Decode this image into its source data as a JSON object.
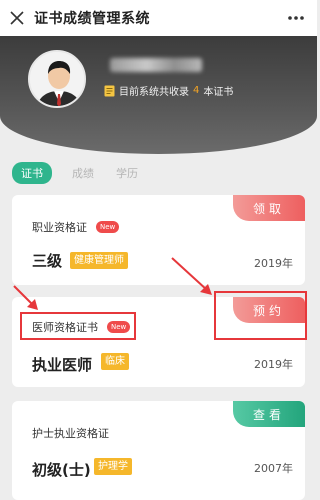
{
  "navbar": {
    "title": "证书成绩管理系统",
    "close_icon": "close-icon",
    "more_icon": "more-dots-icon"
  },
  "hero": {
    "summary_prefix": "目前系统共收录",
    "cert_count": "4",
    "summary_suffix": "本证书"
  },
  "tabs": [
    {
      "label": "证书",
      "active": true
    },
    {
      "label": "成绩",
      "active": false
    },
    {
      "label": "学历",
      "active": false
    }
  ],
  "cards": [
    {
      "title": "职业资格证",
      "badge": "New",
      "grade": "三级",
      "tag": "健康管理师",
      "year": "2019年",
      "action": "领取",
      "action_color": "#ef6a6a"
    },
    {
      "title": "医师资格证书",
      "badge": "New",
      "grade": "执业医师",
      "tag": "临床",
      "year": "2019年",
      "action": "预约",
      "action_color": "#ef6a6a"
    },
    {
      "title": "护士执业资格证",
      "grade": "初级(士)",
      "tag": "护理学",
      "year": "2007年",
      "action": "查看",
      "action_color": "#30b58e"
    }
  ],
  "colors": {
    "accent_green": "#2fb58d",
    "accent_red": "#ef6a6a",
    "tag_yellow": "#f5b72b",
    "annotation_red": "#e6373b"
  }
}
